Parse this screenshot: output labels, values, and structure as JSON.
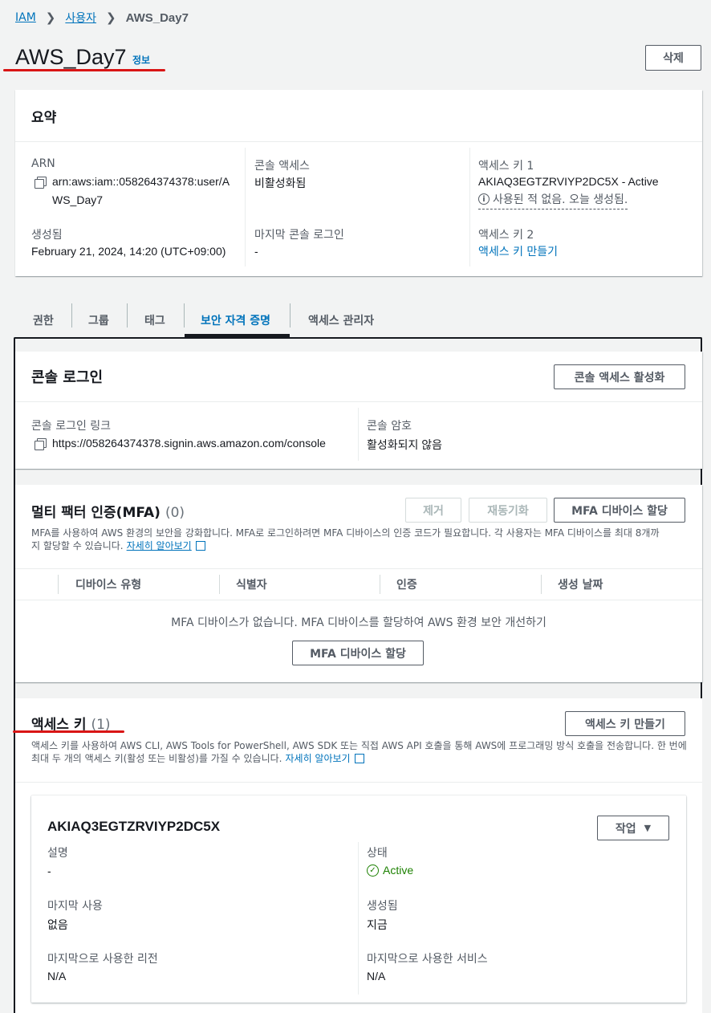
{
  "breadcrumb": {
    "root": "IAM",
    "users": "사용자",
    "current": "AWS_Day7"
  },
  "header": {
    "title": "AWS_Day7",
    "info": "정보",
    "delete_label": "삭제"
  },
  "summary": {
    "title": "요약",
    "arn_label": "ARN",
    "arn_line1": "arn:aws:iam::058264374378:user/A",
    "arn_line2": "WS_Day7",
    "created_label": "생성됨",
    "created_value": "February 21, 2024, 14:20 (UTC+09:00)",
    "console_access_label": "콘솔 액세스",
    "console_access_value": "비활성화됨",
    "last_login_label": "마지막 콘솔 로그인",
    "last_login_value": "-",
    "key1_label": "액세스 키 1",
    "key1_value": "AKIAQ3EGTZRVIYP2DC5X - Active",
    "key1_note": "사용된 적 없음. 오늘 생성됨.",
    "key2_label": "액세스 키 2",
    "key2_link": "액세스 키 만들기"
  },
  "tabs": [
    {
      "label": "권한"
    },
    {
      "label": "그룹"
    },
    {
      "label": "태그"
    },
    {
      "label": "보안 자격 증명",
      "active": true
    },
    {
      "label": "액세스 관리자"
    }
  ],
  "console_login": {
    "title": "콘솔 로그인",
    "enable_button": "콘솔 액세스 활성화",
    "link_label": "콘솔 로그인 링크",
    "link_value": "https://058264374378.signin.aws.amazon.com/console",
    "password_label": "콘솔 암호",
    "password_value": "활성화되지 않음"
  },
  "mfa": {
    "title": "멀티 팩터 인증(MFA)",
    "count": "(0)",
    "remove_button": "제거",
    "resync_button": "재동기화",
    "assign_button": "MFA 디바이스 할당",
    "desc_line1": "MFA를 사용하여 AWS 환경의 보안을 강화합니다. MFA로 로그인하려면 MFA 디바이스의 인증 코드가 필요합니다. 각 사용자는 MFA 디바이스를 최대 8개까",
    "desc_line2": "지 할당할 수 있습니다.",
    "learn_more": "자세히 알아보기",
    "columns": [
      "디바이스 유형",
      "식별자",
      "인증",
      "생성 날짜"
    ],
    "empty_text": "MFA 디바이스가 없습니다. MFA 디바이스를 할당하여 AWS 환경 보안 개선하기",
    "empty_button": "MFA 디바이스 할당"
  },
  "access_keys": {
    "title": "액세스 키",
    "count": "(1)",
    "create_button": "액세스 키 만들기",
    "desc_line1": "액세스 키를 사용하여 AWS CLI, AWS Tools for PowerShell, AWS SDK 또는 직접 AWS API 호출을 통해 AWS에 프로그래밍 방식 호출을 전송합니다. 한 번에",
    "desc_line2": "최대 두 개의 액세스 키(활성 또는 비활성)를 가질 수 있습니다.",
    "learn_more": "자세히 알아보기",
    "key": {
      "id": "AKIAQ3EGTZRVIYP2DC5X",
      "actions_button": "작업",
      "desc_label": "설명",
      "desc_value": "-",
      "status_label": "상태",
      "status_value": "Active",
      "last_used_label": "마지막 사용",
      "last_used_value": "없음",
      "created_label": "생성됨",
      "created_value": "지금",
      "last_region_label": "마지막으로 사용한 리전",
      "last_region_value": "N/A",
      "last_service_label": "마지막으로 사용한 서비스",
      "last_service_value": "N/A"
    }
  },
  "colors": {
    "link": "#0073bb",
    "success": "#1d8102",
    "annotation": "#d91515"
  }
}
